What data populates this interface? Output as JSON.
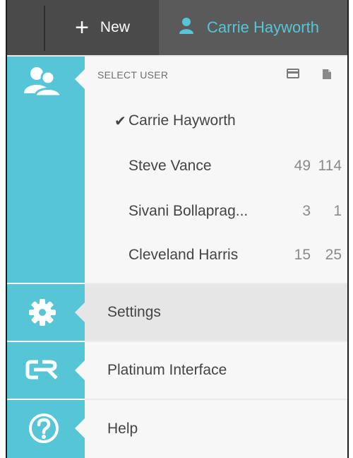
{
  "topbar": {
    "new_label": "New",
    "current_user": "Carrie Hayworth"
  },
  "user_section": {
    "header": "SELECT USER",
    "users": [
      {
        "name": "Carrie Hayworth",
        "selected": true,
        "count1": "",
        "count2": ""
      },
      {
        "name": "Steve Vance",
        "selected": false,
        "count1": "49",
        "count2": "114"
      },
      {
        "name": "Sivani Bollaprag...",
        "selected": false,
        "count1": "3",
        "count2": "1"
      },
      {
        "name": "Cleveland Harris",
        "selected": false,
        "count1": "15",
        "count2": "25"
      }
    ]
  },
  "menu": {
    "settings": "Settings",
    "platinum": "Platinum Interface",
    "help": "Help"
  },
  "rail_logo_text": "CR",
  "colors": {
    "accent": "#56c5d6",
    "topbar": "#4a4a4a",
    "panel": "#f7f7f7",
    "active_row": "#e6e6e6",
    "text": "#444444"
  },
  "icons": {
    "users": "users-icon",
    "person": "person-icon",
    "gear": "gear-icon",
    "logo": "cr-logo-icon",
    "help": "help-icon",
    "card": "card-icon",
    "document": "document-icon",
    "check": "checkmark-icon"
  }
}
